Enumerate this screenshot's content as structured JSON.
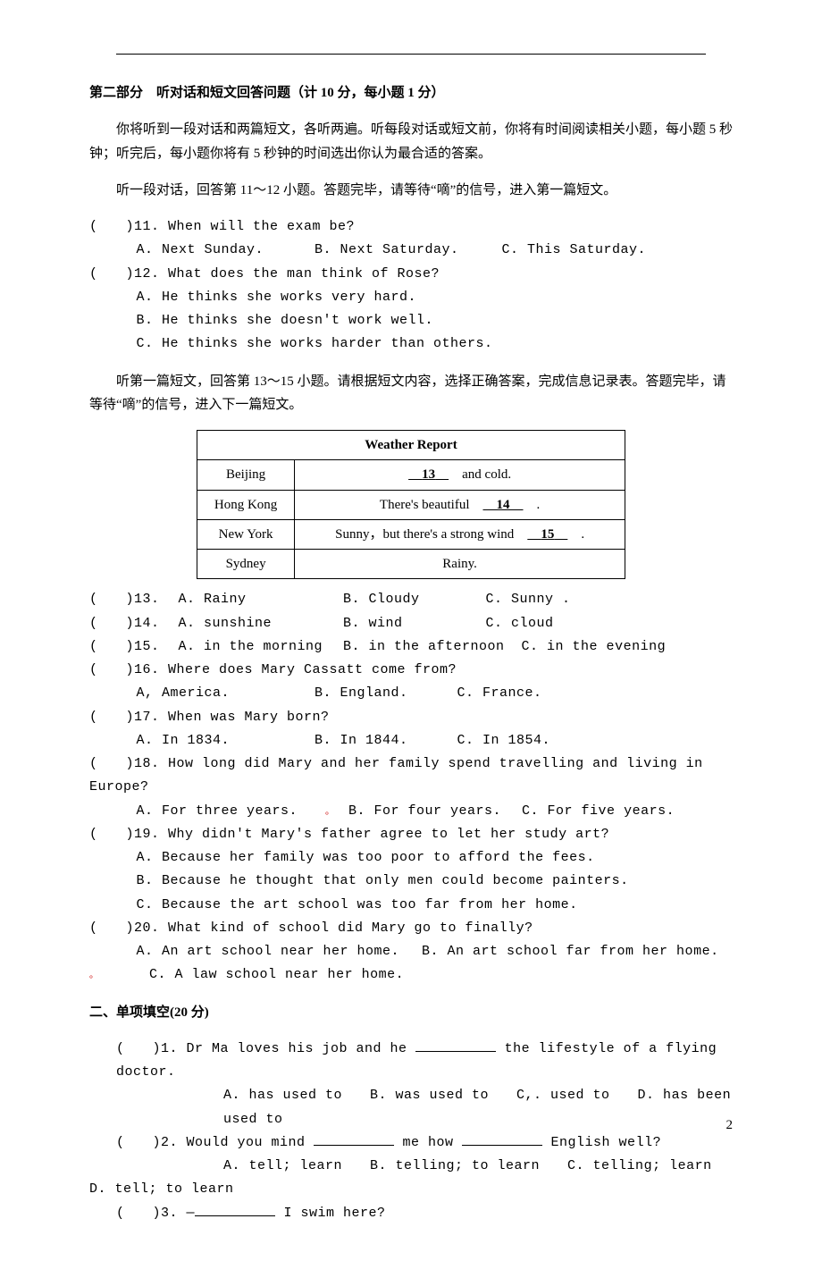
{
  "hr": "",
  "section2": {
    "title": "第二部分　听对话和短文回答问题（计 10 分，每小题 1 分）",
    "intro1": "你将听到一段对话和两篇短文，各听两遍。听每段对话或短文前，你将有时间阅读相关小题，每小题 5 秒钟；听完后，每小题你将有 5 秒钟的时间选出你认为最合适的答案。",
    "intro2": "听一段对话，回答第 11～12 小题。答题完毕，请等待“嘀”的信号，进入第一篇短文。",
    "q11": {
      "num": "(　　)11. When will the exam be?",
      "a": "A. Next Sunday.",
      "b": "B. Next Saturday.",
      "c": "C. This Saturday."
    },
    "q12": {
      "num": "(　　)12. What does the man think of Rose?",
      "a": "A. He thinks she works very hard.",
      "b": "B. He thinks she doesn't work well.",
      "c": "C. He thinks she works harder than others."
    },
    "intro3": "听第一篇短文，回答第 13～15 小题。请根据短文内容，选择正确答案，完成信息记录表。答题完毕，请等待“嘀”的信号，进入下一篇短文。",
    "table": {
      "title": "Weather Report",
      "r1c1": "Beijing",
      "r1c2a": "13",
      "r1c2b": "　and cold.",
      "r2c1": "Hong Kong",
      "r2c2a": "There's beautiful　",
      "r2c2b": "14",
      "r2c2c": "　.",
      "r3c1": "New York",
      "r3c2a": "Sunny，but there's a strong wind　",
      "r3c2b": "15",
      "r3c2c": "　.",
      "r4c1": "Sydney",
      "r4c2": "Rainy."
    },
    "q13": {
      "num": "(　　)13.",
      "a": "A. Rainy",
      "b": "B. Cloudy",
      "c": "C. Sunny ."
    },
    "q14": {
      "num": "(　　)14.",
      "a": "A. sunshine",
      "b": "B. wind",
      "c": "C. cloud"
    },
    "q15": {
      "num": "(　　)15.",
      "a": "A. in the morning",
      "b": "B. in the afternoon",
      "c": "C. in the evening"
    },
    "q16": {
      "num": "(　　)16. Where does Mary Cassatt come from?",
      "a": "A, America.",
      "b": "B. England.",
      "c": "C. France."
    },
    "q17": {
      "num": "(　　)17. When was Mary born?",
      "a": "A. In 1834.",
      "b": "B. In 1844.",
      "c": "C. In 1854."
    },
    "q18": {
      "num": "(　　)18. How long did Mary and her family spend travelling and living in Europe?",
      "a": "A. For three years.　　",
      "dot": "。",
      "b": "　B. For four years.",
      "c": "C. For five years."
    },
    "q19": {
      "num": "(　　)19. Why didn't Mary's father agree to let her study art?",
      "a": "A. Because her family was too poor to afford the fees.",
      "b": "B. Because he thought that only men could become painters.",
      "c": "C. Because the art school was too far from her home."
    },
    "q20": {
      "num": "(　　)20. What kind of school did Mary go to finally?",
      "a": "A. An art school near her home.",
      "b": "B. An art school far from her home.",
      "dot": "。",
      "c": "C. A law school near her home."
    }
  },
  "section_fill": {
    "title": "二、单项填空(20 分)",
    "q1": {
      "stem_a": "(　　)1. Dr Ma loves his job and he ",
      "stem_b": " the lifestyle of a flying doctor.",
      "opts": "A. has used to　　B. was used to　　C,. used to　　D. has been used to"
    },
    "q2": {
      "stem_a": "(　　)2. Would you mind ",
      "stem_b": " me how ",
      "stem_c": " English well?",
      "opts": "A. tell; learn　　B. telling; to learn　　C. telling; learn　　D. tell; to learn"
    },
    "q3": {
      "stem_a": "(　　)3. —",
      "stem_b": " I swim here?"
    }
  },
  "page_num": "2"
}
